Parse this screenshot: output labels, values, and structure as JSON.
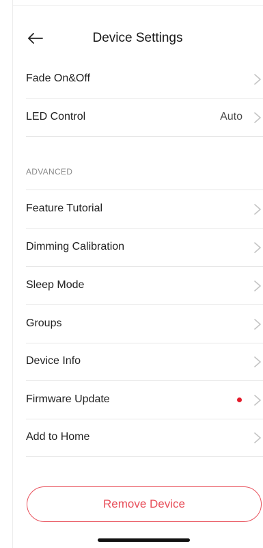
{
  "header": {
    "title": "Device Settings"
  },
  "basic_items": [
    {
      "label": "Fade On&Off",
      "value": ""
    },
    {
      "label": "LED Control",
      "value": "Auto"
    }
  ],
  "advanced": {
    "section_label": "ADVANCED",
    "items": [
      {
        "label": "Feature Tutorial"
      },
      {
        "label": "Dimming Calibration"
      },
      {
        "label": "Sleep Mode"
      },
      {
        "label": "Groups"
      },
      {
        "label": "Device Info"
      },
      {
        "label": "Firmware Update",
        "has_update_dot": true
      },
      {
        "label": "Add to Home"
      }
    ]
  },
  "remove_button": {
    "label": "Remove Device"
  },
  "colors": {
    "accent_red": "#e8505b",
    "update_dot": "#e41b2b",
    "chevron": "#c4c4c4"
  },
  "icons": {
    "back": "arrow-left-icon",
    "row_chevron": "chevron-right-icon",
    "update_indicator": "red-dot-icon"
  }
}
